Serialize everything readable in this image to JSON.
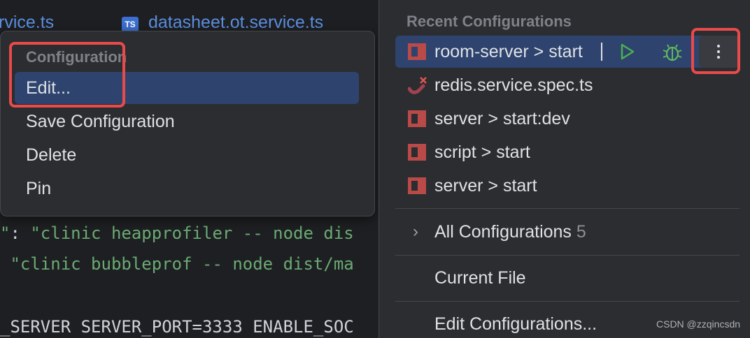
{
  "editor": {
    "tabs": [
      {
        "label": "rvice.ts"
      },
      {
        "badge": "TS",
        "label": "datasheet.ot.service.ts"
      }
    ],
    "code_lines": [
      {
        "prefix": "\"",
        "colon": ": ",
        "text": "\"clinic heapprofiler -- node dis"
      },
      {
        "prefix": " ",
        "colon": "",
        "text": "\"clinic bubbleprof -- node dist/ma"
      },
      {
        "prefix": "",
        "colon": "",
        "text": "_SERVER SERVER_PORT=3333 ENABLE_SOC"
      }
    ]
  },
  "context_menu": {
    "header": "Configuration",
    "items": [
      "Edit...",
      "Save Configuration",
      "Delete",
      "Pin"
    ]
  },
  "run_popup": {
    "header": "Recent Configurations",
    "recent": [
      {
        "label": "room-server > start",
        "icon": "npm-icon"
      },
      {
        "label": "redis.service.spec.ts",
        "icon": "test-icon"
      },
      {
        "label": "server > start:dev",
        "icon": "npm-icon"
      },
      {
        "label": "script > start",
        "icon": "npm-icon"
      },
      {
        "label": "server > start",
        "icon": "npm-icon"
      }
    ],
    "all_configurations_label": "All Configurations",
    "all_configurations_count": "5",
    "current_file_label": "Current File",
    "edit_configurations_label": "Edit Configurations..."
  },
  "watermark": "CSDN @zzqincsdn",
  "colors": {
    "highlight": "#ea4a4a",
    "selection": "#2e436e",
    "npm": "#b94a48",
    "run": "#4caf50",
    "debug": "#5fb85f"
  }
}
